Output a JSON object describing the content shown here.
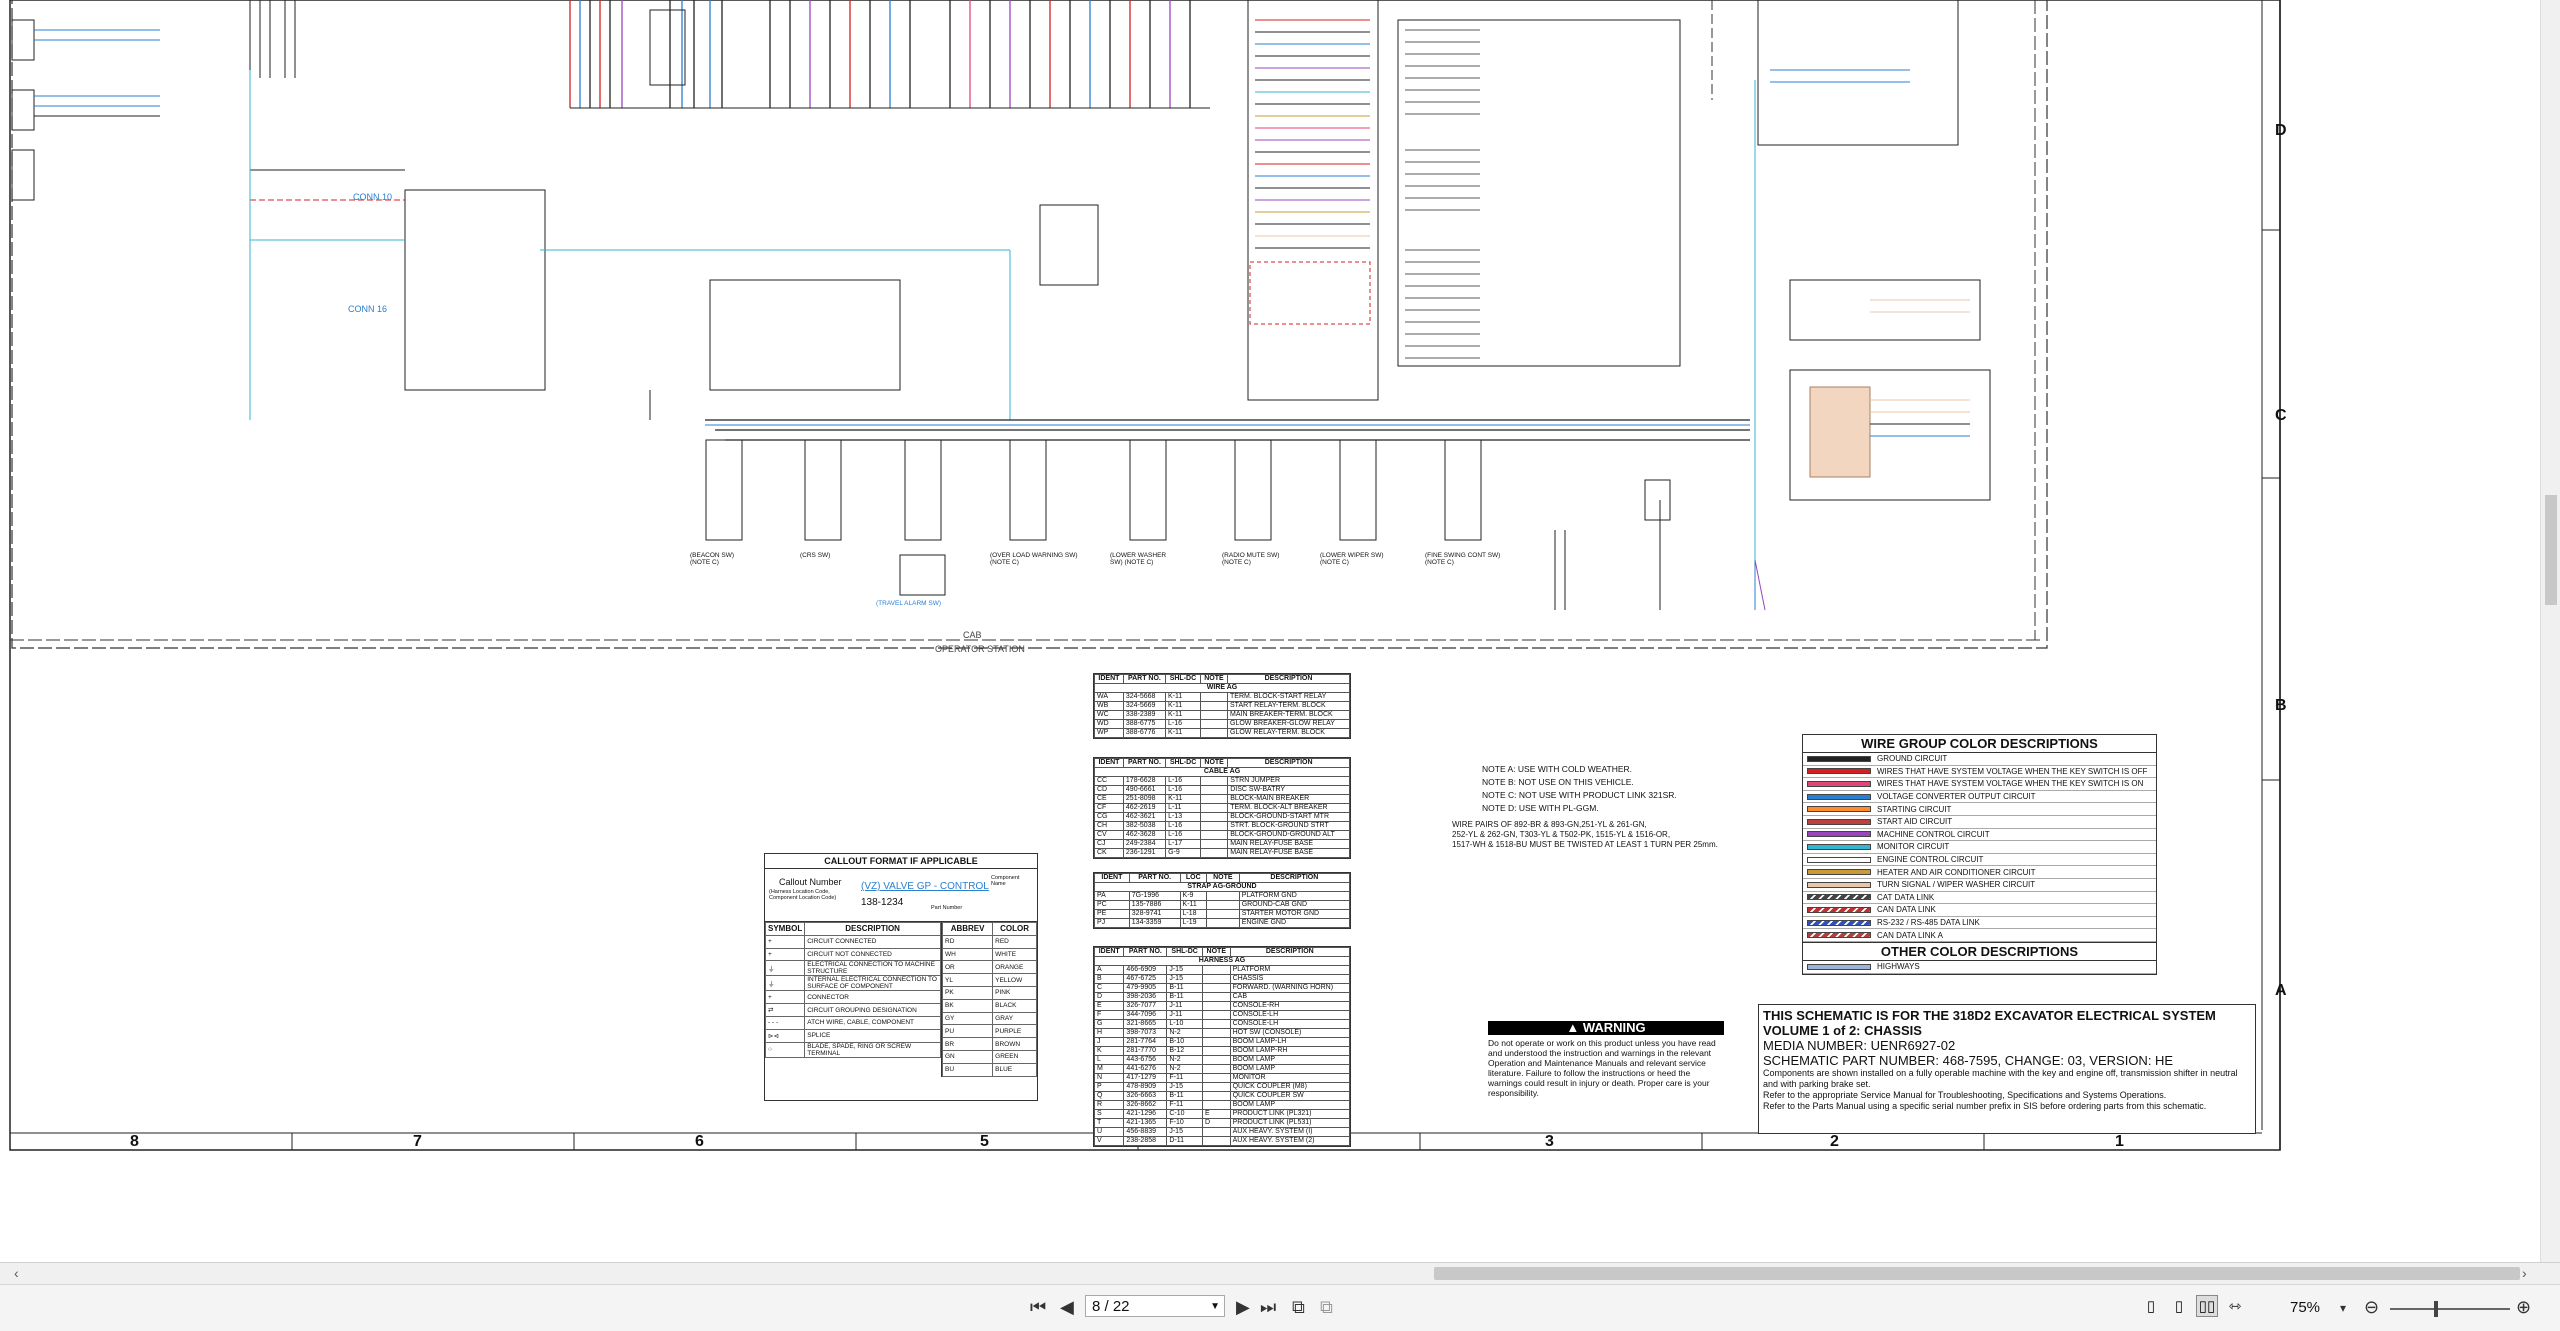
{
  "sheet": {
    "zones_right": [
      "D",
      "C",
      "B",
      "A"
    ],
    "columns": [
      "8",
      "7",
      "6",
      "5",
      "4",
      "3",
      "2",
      "1"
    ],
    "label_cab": "CAB",
    "label_operator": "OPERATOR STATION",
    "connector_labels": [
      "CONN 10",
      "CONN 16"
    ],
    "switch_captions": [
      "(BEACON SW) (NOTE C)",
      "(CRS SW)",
      "(TRAVEL ALARM SW)",
      "(OVER LOAD WARNING SW) (NOTE C)",
      "(LOWER WASHER SW) (NOTE C)",
      "(RADIO MUTE SW) (NOTE C)",
      "(LOWER WIPER SW) (NOTE C)",
      "(FINE SWING CONT SW) (NOTE C)"
    ]
  },
  "tables": {
    "wire_ag": {
      "headers": [
        "IDENT",
        "PART NO.",
        "SHL-DC",
        "NOTE",
        "DESCRIPTION"
      ],
      "title": "WIRE AG",
      "rows": [
        [
          "WA",
          "324-5668",
          "K-11",
          "",
          "TERM. BLOCK-START RELAY"
        ],
        [
          "WB",
          "324-5669",
          "K-11",
          "",
          "START RELAY-TERM. BLOCK"
        ],
        [
          "WC",
          "338-2389",
          "K-11",
          "",
          "MAIN BREAKER-TERM. BLOCK"
        ],
        [
          "WD",
          "388-6775",
          "L-16",
          "",
          "GLOW BREAKER-GLOW RELAY"
        ],
        [
          "WP",
          "388-6776",
          "K-11",
          "",
          "GLOW RELAY-TERM. BLOCK"
        ]
      ]
    },
    "cable_ag": {
      "headers": [
        "IDENT",
        "PART NO.",
        "SHL-DC",
        "NOTE",
        "DESCRIPTION"
      ],
      "title": "CABLE AG",
      "rows": [
        [
          "CC",
          "178-6628",
          "L-16",
          "",
          "STRN JUMPER"
        ],
        [
          "CD",
          "490-6661",
          "L-16",
          "",
          "DISC SW-BATRY"
        ],
        [
          "CE",
          "251-8098",
          "K-11",
          "",
          "BLOCK-MAIN BREAKER"
        ],
        [
          "CF",
          "462-2619",
          "L-11",
          "",
          "TERM. BLOCK-ALT BREAKER"
        ],
        [
          "CG",
          "462-3621",
          "L-13",
          "",
          "BLOCK-GROUND-START MTR"
        ],
        [
          "CH",
          "382-5038",
          "L-16",
          "",
          "STRT. BLOCK-GROUND STRT"
        ],
        [
          "CV",
          "462-3628",
          "L-16",
          "",
          "BLOCK-GROUND-GROUND ALT"
        ],
        [
          "CJ",
          "249-2384",
          "L-17",
          "",
          "MAIN RELAY-FUSE BASE"
        ],
        [
          "CK",
          "236-1291",
          "G-9",
          "",
          "MAIN RELAY-FUSE BASE"
        ]
      ]
    },
    "strap_ag": {
      "headers": [
        "IDENT",
        "PART NO.",
        "LOC",
        "NOTE",
        "DESCRIPTION"
      ],
      "title": "STRAP AG-GROUND",
      "rows": [
        [
          "PA",
          "7G-1996",
          "K-9",
          "",
          "PLATFORM GND"
        ],
        [
          "PC",
          "135-7886",
          "K-11",
          "",
          "GROUND-CAB GND"
        ],
        [
          "PE",
          "328-9741",
          "L-18",
          "",
          "STARTER MOTOR GND"
        ],
        [
          "PJ",
          "134-3359",
          "L-19",
          "",
          "ENGINE GND"
        ]
      ]
    },
    "harness_ag": {
      "headers": [
        "IDENT",
        "PART NO.",
        "SHL-DC",
        "NOTE",
        "DESCRIPTION"
      ],
      "title": "HARNESS AG",
      "rows": [
        [
          "A",
          "466-6909",
          "J-15",
          "",
          "PLATFORM"
        ],
        [
          "B",
          "467-6725",
          "J-15",
          "",
          "CHASSIS"
        ],
        [
          "C",
          "479-9905",
          "B-11",
          "",
          "FORWARD. (WARNING HORN)"
        ],
        [
          "D",
          "398-2036",
          "B-11",
          "",
          "CAB"
        ],
        [
          "E",
          "326-7077",
          "J-11",
          "",
          "CONSOLE-RH"
        ],
        [
          "F",
          "344-7096",
          "J-11",
          "",
          "CONSOLE-LH"
        ],
        [
          "G",
          "321-8665",
          "L-10",
          "",
          "CONSOLE-LH"
        ],
        [
          "H",
          "398-7073",
          "N-2",
          "",
          "HOT SW (CONSOLE)"
        ],
        [
          "J",
          "281-7764",
          "B-10",
          "",
          "BOOM LAMP-LH"
        ],
        [
          "K",
          "281-7770",
          "B-12",
          "",
          "BOOM LAMP-RH"
        ],
        [
          "L",
          "443-6756",
          "N-2",
          "",
          "BOOM LAMP"
        ],
        [
          "M",
          "441-6276",
          "N-2",
          "",
          "BOOM LAMP"
        ],
        [
          "N",
          "417-1279",
          "F-11",
          "",
          "MONITOR"
        ],
        [
          "P",
          "478-8909",
          "J-15",
          "",
          "QUICK COUPLER (M8)"
        ],
        [
          "Q",
          "326-6663",
          "B-11",
          "",
          "QUICK COUPLER SW"
        ],
        [
          "R",
          "326-8662",
          "F-11",
          "",
          "BOOM LAMP"
        ],
        [
          "S",
          "421-1296",
          "C-10",
          "E",
          "PRODUCT LINK (PL321)"
        ],
        [
          "T",
          "421-1365",
          "F-10",
          "D",
          "PRODUCT LINK (PL531)"
        ],
        [
          "U",
          "456-8839",
          "J-15",
          "",
          "AUX HEAVY. SYSTEM (I)"
        ],
        [
          "V",
          "238-2858",
          "D-11",
          "",
          "AUX HEAVY. SYSTEM (2)"
        ]
      ]
    }
  },
  "callout": {
    "title": "CALLOUT FORMAT IF APPLICABLE",
    "callout_number": "Callout Number",
    "callout_sub": "(Harness Location Code, Component Location Code)",
    "component_name": "(VZ) VALVE GP - CONTROL",
    "part_number": "138-1234",
    "component_label": "Component Name",
    "part_label": "Part Number",
    "symbol_headers": [
      "SYMBOL",
      "DESCRIPTION"
    ],
    "symbols": [
      [
        "+",
        "CIRCUIT CONNECTED"
      ],
      [
        "+",
        "CIRCUIT NOT CONNECTED"
      ],
      [
        "⏚",
        "ELECTRICAL CONNECTION TO MACHINE STRUCTURE"
      ],
      [
        "⏚",
        "INTERNAL ELECTRICAL CONNECTION TO SURFACE OF COMPONENT"
      ],
      [
        "+",
        "CONNECTOR"
      ],
      [
        "⇄",
        "CIRCUIT GROUPING DESIGNATION"
      ],
      [
        "- - -",
        "ATCH WIRE, CABLE, COMPONENT"
      ],
      [
        "⊳⊲",
        "SPLICE"
      ],
      [
        "○",
        "BLADE, SPADE, RING OR SCREW TERMINAL"
      ]
    ],
    "abbrev_headers": [
      "ABBREV",
      "COLOR"
    ],
    "abbrevs": [
      [
        "RD",
        "RED"
      ],
      [
        "WH",
        "WHITE"
      ],
      [
        "OR",
        "ORANGE"
      ],
      [
        "YL",
        "YELLOW"
      ],
      [
        "PK",
        "PINK"
      ],
      [
        "BK",
        "BLACK"
      ],
      [
        "GY",
        "GRAY"
      ],
      [
        "PU",
        "PURPLE"
      ],
      [
        "BR",
        "BROWN"
      ],
      [
        "GN",
        "GREEN"
      ],
      [
        "BU",
        "BLUE"
      ]
    ]
  },
  "notes": [
    "NOTE A: USE WITH COLD WEATHER.",
    "NOTE B: NOT USE ON THIS VEHICLE.",
    "NOTE C: NOT USE WITH PRODUCT LINK 321SR.",
    "NOTE D: USE WITH PL-GGM."
  ],
  "wire_note": [
    "WIRE PAIRS OF 892-BR & 893-GN,251-YL & 261-GN,",
    "252-YL & 262-GN, T303-YL & T502-PK, 1515-YL & 1516-OR,",
    "1517-WH & 1518-BU MUST BE TWISTED AT LEAST 1 TURN PER 25mm."
  ],
  "legend": {
    "title": "WIRE GROUP COLOR DESCRIPTIONS",
    "items": [
      {
        "color": "#222222",
        "label": "GROUND CIRCUIT",
        "hatch": false
      },
      {
        "color": "#d42020",
        "label": "WIRES THAT HAVE SYSTEM VOLTAGE WHEN THE KEY SWITCH IS OFF",
        "hatch": false
      },
      {
        "color": "#e0467a",
        "label": "WIRES THAT HAVE SYSTEM VOLTAGE WHEN THE KEY SWITCH IS ON",
        "hatch": false
      },
      {
        "color": "#2a7fd0",
        "label": "VOLTAGE CONVERTER OUTPUT CIRCUIT",
        "hatch": false
      },
      {
        "color": "#ff8c2a",
        "label": "STARTING CIRCUIT",
        "hatch": false
      },
      {
        "color": "#c03f3f",
        "label": "START AID CIRCUIT",
        "hatch": false
      },
      {
        "color": "#9a44c0",
        "label": "MACHINE CONTROL CIRCUIT",
        "hatch": false
      },
      {
        "color": "#34b6d0",
        "label": "MONITOR CIRCUIT",
        "hatch": false
      },
      {
        "color": "#ffffff",
        "label": "ENGINE CONTROL CIRCUIT",
        "hatch": false
      },
      {
        "color": "#c99a3a",
        "label": "HEATER AND AIR CONDITIONER CIRCUIT",
        "hatch": false
      },
      {
        "color": "#e8c6a8",
        "label": "TURN SIGNAL / WIPER WASHER CIRCUIT",
        "hatch": false
      },
      {
        "color": "#444444",
        "label": "CAT DATA LINK",
        "hatch": true
      },
      {
        "color": "#c03030",
        "label": "CAN DATA LINK",
        "hatch": true
      },
      {
        "color": "#3050c0",
        "label": "RS-232 / RS-485 DATA LINK",
        "hatch": true
      },
      {
        "color": "#b04040",
        "label": "CAN DATA LINK A",
        "hatch": true
      }
    ],
    "other_title": "OTHER COLOR DESCRIPTIONS",
    "other_items": [
      {
        "color": "#9cb4d8",
        "label": "HIGHWAYS",
        "hatch": false
      }
    ]
  },
  "warning": {
    "title": "WARNING",
    "body": "Do not operate or work on this product unless you have read and understood the instruction and warnings in the relevant Operation and Maintenance Manuals and relevant service literature. Failure to follow the instructions or heed the warnings could result in injury or death. Proper care is your responsibility."
  },
  "title_block": {
    "line1": "THIS SCHEMATIC IS FOR THE 318D2 EXCAVATOR ELECTRICAL SYSTEM",
    "line2": "VOLUME 1 of 2: CHASSIS",
    "line3": "MEDIA NUMBER: UENR6927-02",
    "line4": "SCHEMATIC PART NUMBER: 468-7595, CHANGE: 03, VERSION: HE",
    "line5": "Components are shown installed on a fully operable machine with the key and engine off, transmission shifter in neutral and with parking brake set.",
    "line6": "Refer to the appropriate Service Manual for Troubleshooting, Specifications and Systems Operations.",
    "line7": "Refer to the Parts Manual using a specific serial number prefix in SIS before ordering parts from this schematic."
  },
  "viewer": {
    "page_current": "8",
    "page_total": "22",
    "page_display": "8 / 22",
    "zoom": "75%",
    "icons": {
      "first": "first-page-icon",
      "prev": "prev-page-icon",
      "next": "next-page-icon",
      "last": "last-page-icon"
    }
  }
}
